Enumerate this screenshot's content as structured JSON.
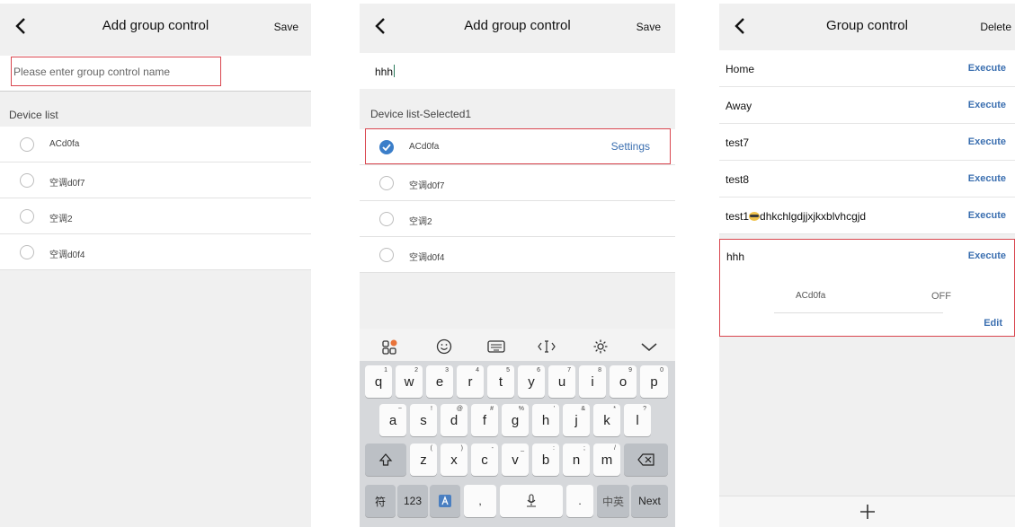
{
  "screen1": {
    "title": "Add group control",
    "save": "Save",
    "name_placeholder": "Please enter group control name",
    "section": "Device list",
    "devices": [
      "ACd0fa",
      "空调d0f7",
      "空调2",
      "空调d0f4"
    ]
  },
  "screen2": {
    "title": "Add group control",
    "save": "Save",
    "name_value": "hhh",
    "section": "Device list-Selected1",
    "devices": [
      {
        "name": "ACd0fa",
        "selected": true,
        "action": "Settings"
      },
      {
        "name": "空调d0f7",
        "selected": false
      },
      {
        "name": "空调2",
        "selected": false
      },
      {
        "name": "空调d0f4",
        "selected": false
      }
    ],
    "keyboard": {
      "row1": [
        [
          "q",
          "1"
        ],
        [
          "w",
          "2"
        ],
        [
          "e",
          "3"
        ],
        [
          "r",
          "4"
        ],
        [
          "t",
          "5"
        ],
        [
          "y",
          "6"
        ],
        [
          "u",
          "7"
        ],
        [
          "i",
          "8"
        ],
        [
          "o",
          "9"
        ],
        [
          "p",
          "0"
        ]
      ],
      "row2": [
        [
          "a",
          "~"
        ],
        [
          "s",
          "!"
        ],
        [
          "d",
          "@"
        ],
        [
          "f",
          "#"
        ],
        [
          "g",
          "%"
        ],
        [
          "h",
          "'"
        ],
        [
          "j",
          "&"
        ],
        [
          "k",
          "*"
        ],
        [
          "l",
          "?"
        ]
      ],
      "row3": [
        [
          "z",
          "("
        ],
        [
          "x",
          ")"
        ],
        [
          "c",
          "-"
        ],
        [
          "v",
          "_"
        ],
        [
          "b",
          ":"
        ],
        [
          "n",
          ";"
        ],
        [
          "m",
          "/"
        ]
      ],
      "bottom": {
        "sym": "符",
        "num": "123",
        "comma": ",",
        "dot": ".",
        "lang": "中英",
        "next": "Next"
      }
    }
  },
  "screen3": {
    "title": "Group control",
    "delete": "Delete",
    "groups": [
      {
        "name": "Home",
        "action": "Execute"
      },
      {
        "name": "Away",
        "action": "Execute"
      },
      {
        "name": "test7",
        "action": "Execute"
      },
      {
        "name": "test8",
        "action": "Execute"
      },
      {
        "name_pre": "test1",
        "name_post": "dhkchlgdjjxjkxblvhcgjd",
        "action": "Execute"
      }
    ],
    "expanded": {
      "name": "hhh",
      "action": "Execute",
      "device": "ACd0fa",
      "state": "OFF",
      "edit": "Edit"
    }
  },
  "colors": {
    "accent": "#3b6fb0",
    "highlight_border": "#d9464f",
    "selected_radio": "#3b7ec9"
  }
}
